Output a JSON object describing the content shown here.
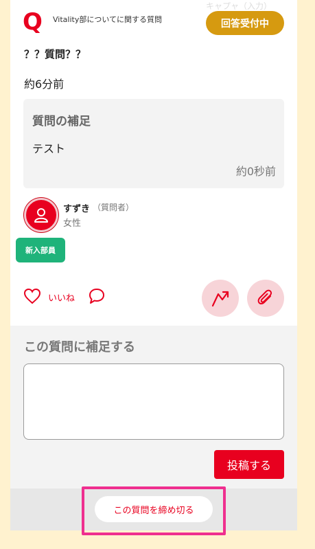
{
  "header": {
    "q_mark": "Q",
    "category": "Vitality部についてに関する質問",
    "status_badge": "回答受付中",
    "faint_text": "キャプャ（入力）"
  },
  "question": {
    "title": "？？質問？？",
    "posted_time": "約6分前"
  },
  "supplement": {
    "heading": "質問の補足",
    "body": "テスト",
    "time": "約0秒前"
  },
  "user": {
    "name": "すずき",
    "role": "（質問者）",
    "gender": "女性",
    "member_badge": "新入部員"
  },
  "actions": {
    "like_label": "いいね",
    "icons": [
      "heart-icon",
      "comment-icon",
      "share-arrow-icon",
      "paperclip-icon"
    ]
  },
  "supplement_form": {
    "heading": "この質問に補足する",
    "textarea_value": "",
    "post_label": "投稿する"
  },
  "footer": {
    "close_label": "この質問を締め切る"
  },
  "colors": {
    "accent": "#e8001f",
    "badge_gold": "#d69a10",
    "badge_green": "#1fb37a",
    "highlight": "#ef2f8f",
    "page_bg": "#fff2cf"
  }
}
